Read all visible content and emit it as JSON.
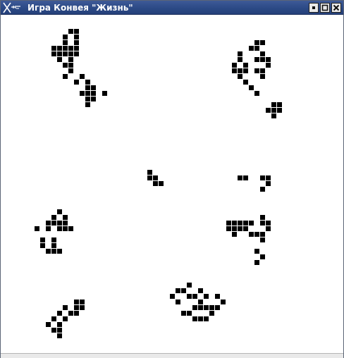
{
  "window": {
    "title": "Игра Конвея \"Жизнь\"",
    "titlebar_color": "#2c4a86",
    "title_color": "#ffffff",
    "controls": [
      {
        "name": "minimize",
        "icon": "dot-icon"
      },
      {
        "name": "maximize",
        "icon": "square-icon"
      },
      {
        "name": "close",
        "icon": "x-icon"
      }
    ]
  },
  "board": {
    "live_cell_color": "#000000",
    "background_color": "#ffffff",
    "live_cells": [
      [
        12,
        3
      ],
      [
        13,
        3
      ],
      [
        11,
        4
      ],
      [
        13,
        4
      ],
      [
        11,
        5
      ],
      [
        13,
        5
      ],
      [
        9,
        6
      ],
      [
        10,
        6
      ],
      [
        11,
        6
      ],
      [
        12,
        6
      ],
      [
        13,
        6
      ],
      [
        9,
        7
      ],
      [
        10,
        7
      ],
      [
        11,
        7
      ],
      [
        12,
        7
      ],
      [
        13,
        7
      ],
      [
        10,
        8
      ],
      [
        12,
        8
      ],
      [
        11,
        9
      ],
      [
        12,
        9
      ],
      [
        45,
        5
      ],
      [
        46,
        5
      ],
      [
        44,
        6
      ],
      [
        45,
        6
      ],
      [
        42,
        7
      ],
      [
        46,
        7
      ],
      [
        42,
        8
      ],
      [
        45,
        8
      ],
      [
        46,
        8
      ],
      [
        47,
        8
      ],
      [
        41,
        9
      ],
      [
        43,
        9
      ],
      [
        47,
        9
      ],
      [
        41,
        10
      ],
      [
        42,
        10
      ],
      [
        43,
        10
      ],
      [
        45,
        10
      ],
      [
        46,
        10
      ],
      [
        42,
        11
      ],
      [
        46,
        11
      ],
      [
        43,
        12
      ],
      [
        44,
        13
      ],
      [
        45,
        14
      ],
      [
        12,
        10
      ],
      [
        11,
        11
      ],
      [
        14,
        11
      ],
      [
        13,
        12
      ],
      [
        15,
        12
      ],
      [
        15,
        13
      ],
      [
        16,
        13
      ],
      [
        14,
        14
      ],
      [
        15,
        14
      ],
      [
        16,
        14
      ],
      [
        18,
        14
      ],
      [
        15,
        15
      ],
      [
        16,
        15
      ],
      [
        15,
        16
      ],
      [
        48,
        16
      ],
      [
        49,
        16
      ],
      [
        47,
        17
      ],
      [
        48,
        17
      ],
      [
        49,
        17
      ],
      [
        48,
        18
      ],
      [
        26,
        28
      ],
      [
        26,
        29
      ],
      [
        27,
        29
      ],
      [
        27,
        30
      ],
      [
        28,
        30
      ],
      [
        42,
        29
      ],
      [
        43,
        29
      ],
      [
        46,
        29
      ],
      [
        47,
        29
      ],
      [
        47,
        30
      ],
      [
        46,
        31
      ],
      [
        10,
        35
      ],
      [
        9,
        36
      ],
      [
        11,
        36
      ],
      [
        8,
        37
      ],
      [
        9,
        37
      ],
      [
        10,
        37
      ],
      [
        11,
        37
      ],
      [
        6,
        38
      ],
      [
        8,
        38
      ],
      [
        10,
        38
      ],
      [
        11,
        38
      ],
      [
        12,
        38
      ],
      [
        7,
        40
      ],
      [
        9,
        40
      ],
      [
        7,
        41
      ],
      [
        9,
        41
      ],
      [
        8,
        42
      ],
      [
        9,
        42
      ],
      [
        10,
        42
      ],
      [
        46,
        36
      ],
      [
        46,
        37
      ],
      [
        47,
        37
      ],
      [
        40,
        37
      ],
      [
        41,
        37
      ],
      [
        42,
        37
      ],
      [
        43,
        37
      ],
      [
        44,
        37
      ],
      [
        46,
        37
      ],
      [
        40,
        38
      ],
      [
        41,
        38
      ],
      [
        42,
        38
      ],
      [
        43,
        38
      ],
      [
        47,
        38
      ],
      [
        41,
        39
      ],
      [
        44,
        39
      ],
      [
        45,
        39
      ],
      [
        46,
        39
      ],
      [
        46,
        40
      ],
      [
        45,
        42
      ],
      [
        46,
        43
      ],
      [
        45,
        44
      ],
      [
        33,
        48
      ],
      [
        31,
        49
      ],
      [
        32,
        49
      ],
      [
        35,
        49
      ],
      [
        30,
        50
      ],
      [
        33,
        50
      ],
      [
        34,
        50
      ],
      [
        36,
        50
      ],
      [
        38,
        50
      ],
      [
        31,
        51
      ],
      [
        35,
        51
      ],
      [
        39,
        51
      ],
      [
        34,
        52
      ],
      [
        35,
        52
      ],
      [
        36,
        52
      ],
      [
        37,
        52
      ],
      [
        38,
        52
      ],
      [
        32,
        53
      ],
      [
        33,
        53
      ],
      [
        37,
        53
      ],
      [
        34,
        54
      ],
      [
        35,
        54
      ],
      [
        36,
        54
      ],
      [
        13,
        51
      ],
      [
        14,
        51
      ],
      [
        11,
        52
      ],
      [
        13,
        52
      ],
      [
        14,
        52
      ],
      [
        10,
        53
      ],
      [
        12,
        53
      ],
      [
        13,
        53
      ],
      [
        9,
        54
      ],
      [
        11,
        54
      ],
      [
        8,
        55
      ],
      [
        10,
        55
      ],
      [
        9,
        56
      ],
      [
        10,
        56
      ],
      [
        10,
        57
      ]
    ]
  }
}
